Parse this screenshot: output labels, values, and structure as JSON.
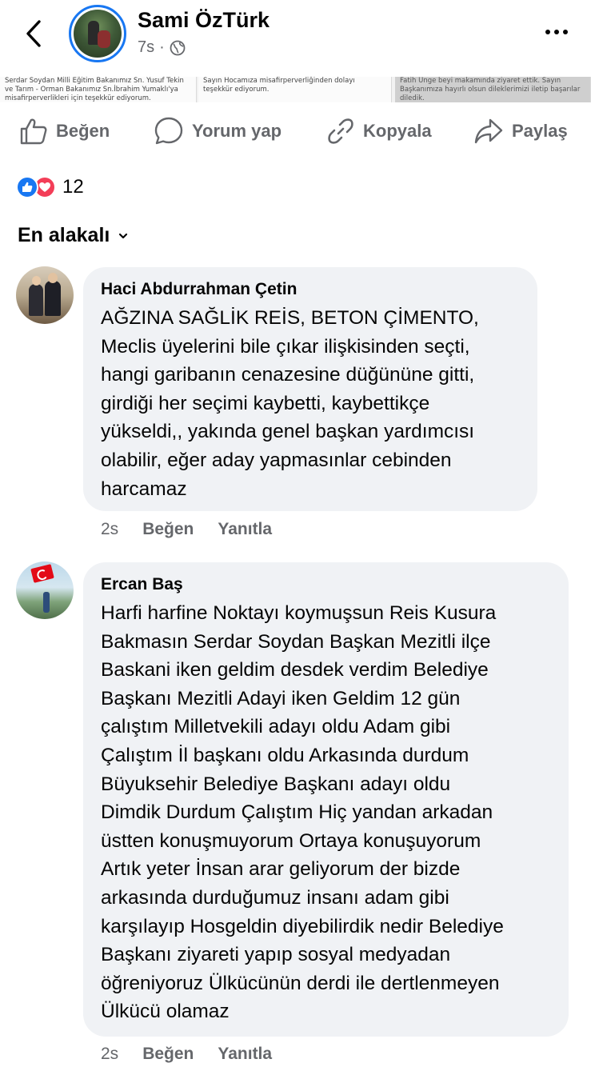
{
  "header": {
    "back_icon": "chevron-left-icon",
    "author_name": "Sami ÖzTürk",
    "time_ago": "7s",
    "separator": "·",
    "privacy_icon": "globe-icon",
    "more_icon": "more-horizontal-icon"
  },
  "image_strip": {
    "tile_1_text": "Serdar Soydan Milli Eğitim Bakanımız Sn. Yusuf Tekin ve Tarım - Orman Bakanımız Sn.İbrahim Yumaklı'ya misafirperverlikleri için teşekkür ediyorum.",
    "tile_2_text": "Sayın Hocamıza misafirperverliğinden dolayı teşekkür ediyorum.",
    "tile_3_text": "Fatih Ünge beyi makamında ziyaret ettik. Sayın Başkanımıza hayırlı olsun dileklerimizi iletip başarılar diledik."
  },
  "actions": {
    "like_label": "Beğen",
    "comment_label": "Yorum yap",
    "copy_label": "Kopyala",
    "share_label": "Paylaş"
  },
  "reactions": {
    "count": "12",
    "like_color": "#1877f2",
    "love_color": "#f33e58"
  },
  "sort": {
    "label": "En alakalı"
  },
  "comments": [
    {
      "author": "Haci Abdurrahman Çetin",
      "text": "AĞZINA SAĞLİK REİS, BETON ÇİMENTO,\nMeclis üyelerini bile çıkar ilişkisinden seçti,\nhangi garibanın cenazesine düğününe gitti,\ngirdiği her seçimi kaybetti, kaybettikçe\nyükseldi,, yakında genel başkan yardımcısı\nolabilir, eğer aday yapmasınlar cebinden\nharcamaz",
      "time": "2s",
      "like_label": "Beğen",
      "reply_label": "Yanıtla"
    },
    {
      "author": "Ercan Baş",
      "text": "Harfi harfine Noktayı koymuşsun Reis Kusura\nBakmasın Serdar Soydan  Başkan Mezitli ilçe\nBaskani iken geldim desdek verdim Belediye\nBaşkanı Mezitli Adayi iken Geldim 12 gün\nçalıştım Milletvekili adayı oldu Adam gibi\nÇalıştım İl başkanı oldu Arkasında durdum\nBüyuksehir Belediye Başkanı adayı oldu\nDimdik Durdum Çalıştım Hiç yandan arkadan\nüstten konuşmuyorum Ortaya konuşuyorum\nArtık yeter İnsan arar geliyorum der bizde\narkasında durduğumuz insanı adam gibi\nkarşılayıp Hosgeldin diyebilirdik nedir Belediye\nBaşkanı ziyareti yapıp sosyal medyadan\nöğreniyoruz Ülkücünün derdi ile dertlenmeyen\nÜlkücü olamaz",
      "time": "2s",
      "like_label": "Beğen",
      "reply_label": "Yanıtla"
    }
  ]
}
